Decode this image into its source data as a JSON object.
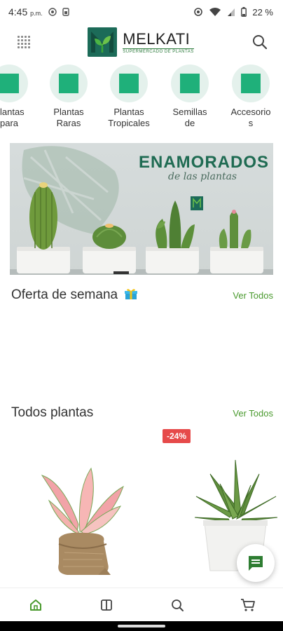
{
  "status_bar": {
    "time": "4:45",
    "ampm": "p.m.",
    "battery": "22 %",
    "icons": [
      "record-icon",
      "sim-icon",
      "eye-icon",
      "wifi-icon",
      "signal-icon",
      "battery-icon"
    ]
  },
  "header": {
    "brand": "MELKATI",
    "tagline": "SUPERMERCADO DE PLANTAS",
    "menu_icon": "grid-menu-icon",
    "search_icon": "search-icon"
  },
  "categories": [
    {
      "line1": "Plantas",
      "line2": "para"
    },
    {
      "line1": "Plantas",
      "line2": "Raras"
    },
    {
      "line1": "Plantas",
      "line2": "Tropicales"
    },
    {
      "line1": "Semillas",
      "line2": "de"
    },
    {
      "line1": "Accesorio",
      "line2": "s"
    }
  ],
  "banner": {
    "title": "ENAMORADOS",
    "subtitle": "de las plantas"
  },
  "offer_section": {
    "title": "Oferta de semana",
    "see_all": "Ver Todos"
  },
  "plants_section": {
    "title": "Todos plantas",
    "see_all": "Ver Todos"
  },
  "products": {
    "discount_badge": "-24%"
  },
  "colors": {
    "brand_green": "#1c7a63",
    "accent_green": "#4a9a2e",
    "category_square": "#1fb07a",
    "discount_red": "#e64a4a"
  },
  "bottom_nav": [
    "home-icon",
    "catalog-icon",
    "search-icon",
    "cart-icon"
  ]
}
